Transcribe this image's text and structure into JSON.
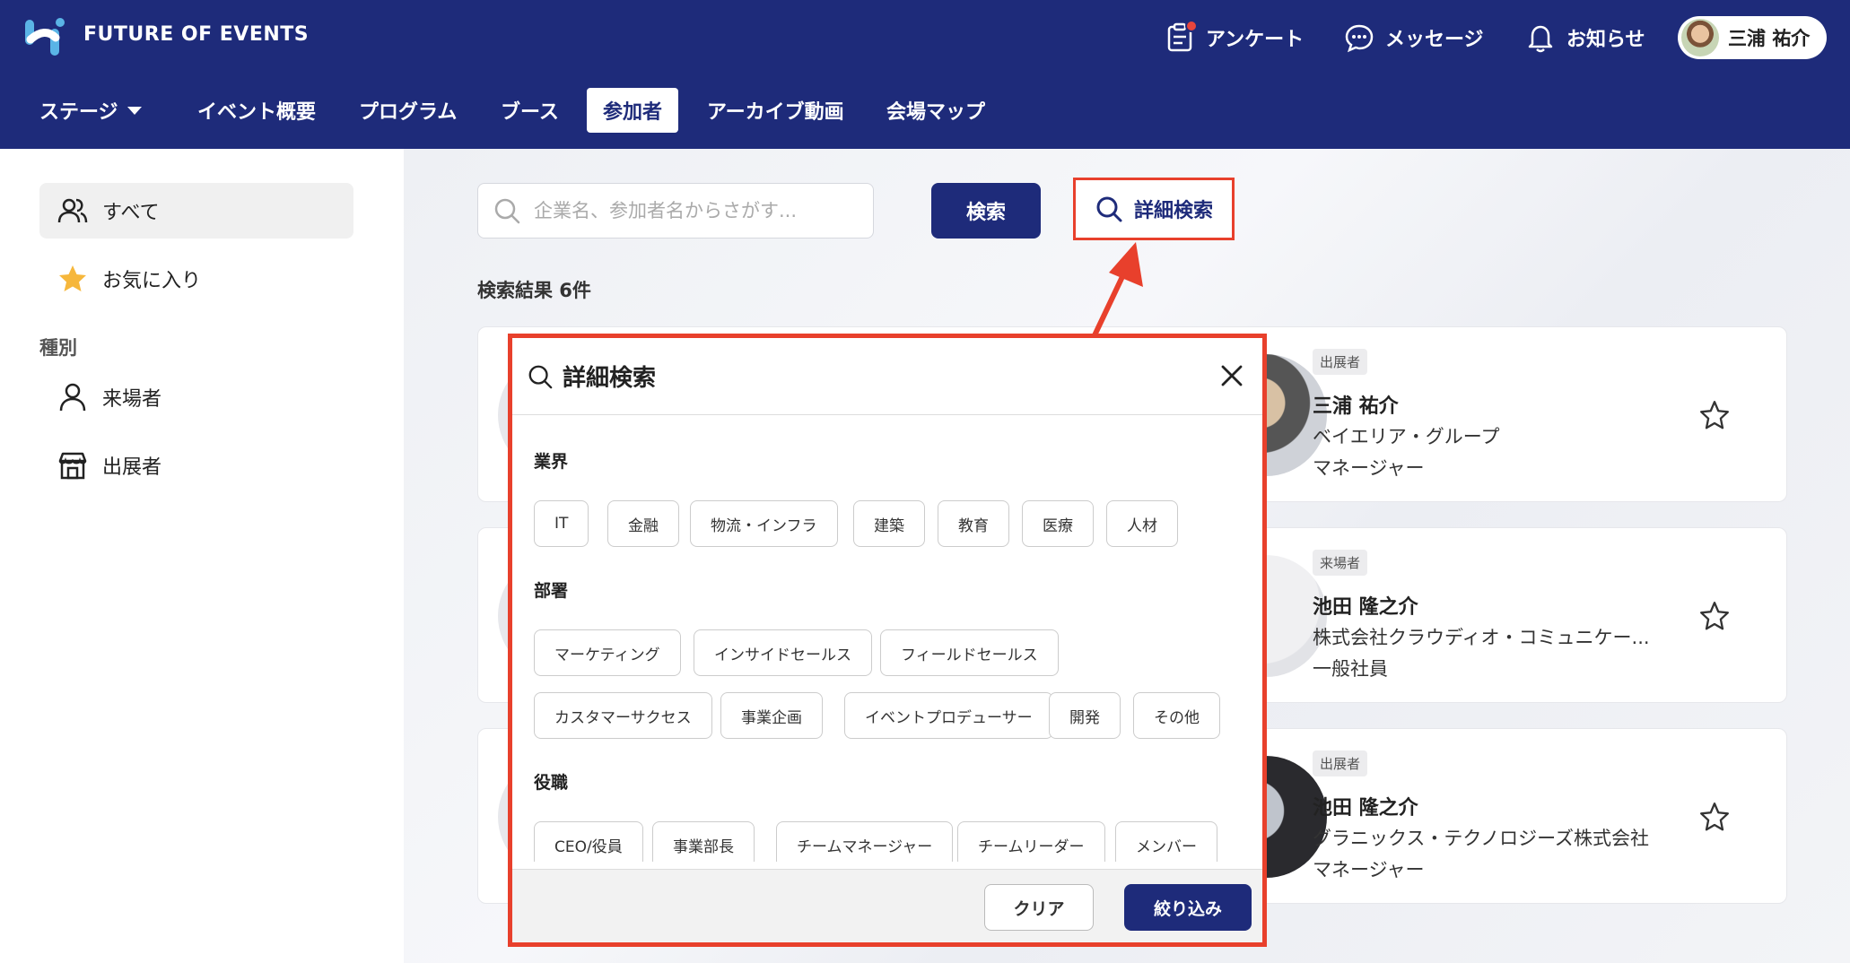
{
  "header": {
    "brand": "FUTURE OF EVENTS",
    "survey_label": "アンケート",
    "messages_label": "メッセージ",
    "notifications_label": "お知らせ",
    "user_name": "三浦 祐介"
  },
  "nav": {
    "items": [
      {
        "label": "ステージ"
      },
      {
        "label": "イベント概要"
      },
      {
        "label": "プログラム"
      },
      {
        "label": "ブース"
      },
      {
        "label": "参加者"
      },
      {
        "label": "アーカイブ動画"
      },
      {
        "label": "会場マップ"
      }
    ],
    "active": "参加者"
  },
  "sidebar": {
    "all_label": "すべて",
    "favorites_label": "お気に入り",
    "section_label": "種別",
    "visitor_label": "来場者",
    "exhibitor_label": "出展者"
  },
  "search": {
    "placeholder": "企業名、参加者名からさがす...",
    "button_label": "検索",
    "advanced_label": "詳細検索",
    "result_count": "検索結果 6件"
  },
  "cards": [
    {
      "badge": "出展者",
      "name": "三浦 祐介",
      "company": "ベイエリア・グループ",
      "title": "マネージャー"
    },
    {
      "badge": "来場者",
      "name": "池田 隆之介",
      "company": "株式会社クラウディオ・コミュニケー...",
      "title": "一般社員"
    },
    {
      "badge": "出展者",
      "name": "池田 隆之介",
      "company": "グラニックス・テクノロジーズ株式会社",
      "title": "マネージャー"
    }
  ],
  "modal": {
    "title": "詳細検索",
    "groups": [
      {
        "label": "業界",
        "chips": [
          "IT",
          "金融",
          "物流・インフラ",
          "建築",
          "教育",
          "医療",
          "人材"
        ]
      },
      {
        "label": "部署",
        "chips": [
          "マーケティング",
          "インサイドセールス",
          "フィールドセールス",
          "カスタマーサクセス",
          "事業企画",
          "イベントプロデューサー",
          "開発",
          "その他"
        ]
      },
      {
        "label": "役職",
        "chips": [
          "CEO/役員",
          "事業部長",
          "チームマネージャー",
          "チームリーダー",
          "メンバー"
        ]
      }
    ],
    "clear_label": "クリア",
    "apply_label": "絞り込み"
  },
  "colors": {
    "brand_navy": "#1e2b7a",
    "highlight_red": "#e8402c",
    "logo_blue": "#5ab4e6"
  }
}
